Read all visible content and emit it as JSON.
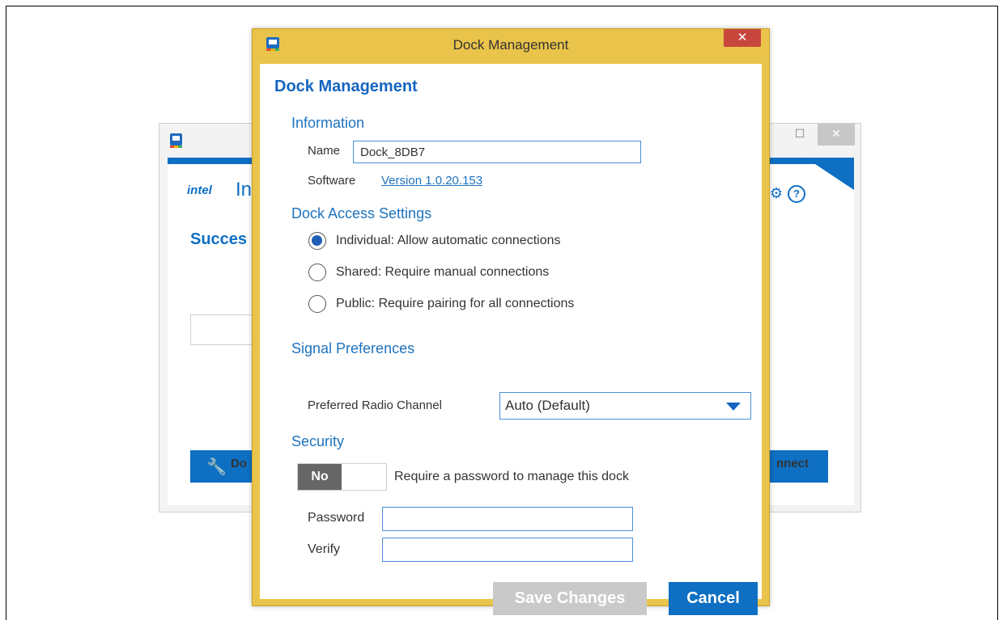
{
  "background_window": {
    "brand": "intel",
    "app_name_partial": "In",
    "title_partial": "Succes",
    "close_glyph": "✕",
    "maximize_glyph": "☐",
    "left_button_label": "Do",
    "right_button_label": "nnect",
    "help_glyph": "?",
    "gear_glyph": "⚙",
    "wrench_glyph": "🔧"
  },
  "dialog": {
    "window_title": "Dock Management",
    "close_glyph": "✕",
    "heading": "Dock Management",
    "information": {
      "section_title": "Information",
      "name_label": "Name",
      "name_value": "Dock_8DB7",
      "software_label": "Software",
      "software_link": "Version 1.0.20.153"
    },
    "access": {
      "section_title": "Dock Access Settings",
      "options": [
        {
          "label": "Individual: Allow automatic connections",
          "checked": true
        },
        {
          "label": "Shared: Require manual connections",
          "checked": false
        },
        {
          "label": "Public: Require pairing for all connections",
          "checked": false
        }
      ]
    },
    "signal": {
      "section_title": "Signal Preferences",
      "channel_label": "Preferred Radio Channel",
      "channel_value": "Auto (Default)"
    },
    "security": {
      "section_title": "Security",
      "toggle_label": "No",
      "toggle_description": "Require a password to manage this dock",
      "password_label": "Password",
      "verify_label": "Verify",
      "password_value": "",
      "verify_value": ""
    },
    "buttons": {
      "save": "Save Changes",
      "cancel": "Cancel"
    }
  },
  "colors": {
    "accent": "#0e6fc3",
    "dialog_border": "#eac44a",
    "close_red": "#c7473d",
    "disabled": "#c9c9c9"
  }
}
